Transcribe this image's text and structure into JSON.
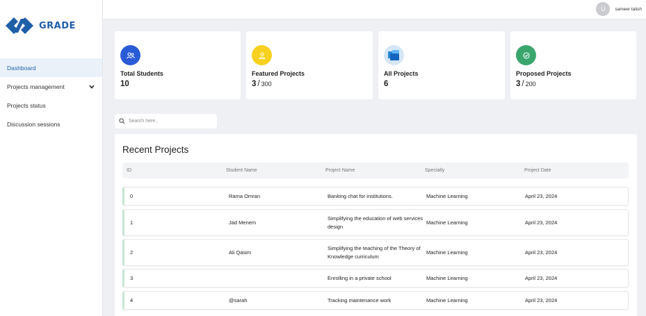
{
  "app": {
    "logo_text": "GRADE"
  },
  "user": {
    "avatar_letter": "U",
    "name": "sameer talish"
  },
  "sidebar": {
    "items": [
      {
        "label": "Dashboard"
      },
      {
        "label": "Projects management"
      },
      {
        "label": "Projects status"
      },
      {
        "label": "Discussion sessions"
      }
    ]
  },
  "cards": [
    {
      "title": "Total Students",
      "value": "10",
      "icon": "users-icon",
      "color": "#2a5bd7"
    },
    {
      "title": "Featured Projects",
      "value": "3",
      "sep": "/",
      "total": "300",
      "icon": "user-icon",
      "color": "#f7d11e"
    },
    {
      "title": "All Projects",
      "value": "6",
      "icon": "folders-icon",
      "color": "#d6e6f7"
    },
    {
      "title": "Proposed Projects",
      "value": "3",
      "sep": "/",
      "total": "200",
      "icon": "check-badge-icon",
      "color": "#3aa66e"
    }
  ],
  "search": {
    "placeholder": "Search here.."
  },
  "table": {
    "title": "Recent Projects",
    "headers": [
      "ID",
      "Student Name",
      "Project Name",
      "Specialty",
      "Project Date"
    ],
    "rows": [
      {
        "id": "0",
        "student": "Rama Omran",
        "project": "Banking chat for institutions.",
        "specialty": "Machine Learning",
        "date": "April 23, 2024"
      },
      {
        "id": "1",
        "student": "Jad Menem",
        "project": "Simplifying the education of web services design",
        "specialty": "Machine Learning",
        "date": "April 23, 2024"
      },
      {
        "id": "2",
        "student": "Ali Qasim",
        "project": "Simplifying the teaching of the Theory of Knowledge curriculum",
        "specialty": "Machine Learning",
        "date": "April 23, 2024"
      },
      {
        "id": "3",
        "student": "",
        "project": "Enrolling in a private school",
        "specialty": "Machine Learning",
        "date": "April 23, 2024"
      },
      {
        "id": "4",
        "student": "@sarah",
        "project": "Tracking maintenance work",
        "specialty": "Machine Learning",
        "date": "April 23, 2024"
      }
    ]
  }
}
